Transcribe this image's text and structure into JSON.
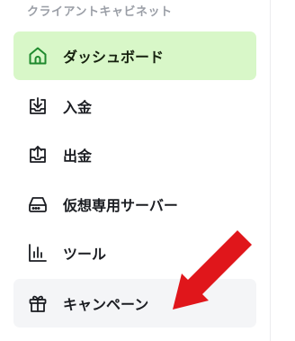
{
  "sidebar": {
    "section_title": "クライアントキャビネット",
    "items": [
      {
        "label": "ダッシュボード",
        "icon": "home-icon",
        "state": "active"
      },
      {
        "label": "入金",
        "icon": "download-tray-icon",
        "state": "default"
      },
      {
        "label": "出金",
        "icon": "upload-tray-icon",
        "state": "default"
      },
      {
        "label": "仮想専用サーバー",
        "icon": "server-drive-icon",
        "state": "default"
      },
      {
        "label": "ツール",
        "icon": "bar-chart-icon",
        "state": "default"
      },
      {
        "label": "キャンペーン",
        "icon": "gift-icon",
        "state": "hover"
      }
    ]
  },
  "colors": {
    "active_bg": "#d8f7c8",
    "active_icon": "#1f8a2e",
    "hover_bg": "#f4f5f7",
    "arrow": "#e0161b",
    "section_title": "#9a9ea6"
  },
  "annotation": {
    "icon": "red-arrow-pointer"
  }
}
